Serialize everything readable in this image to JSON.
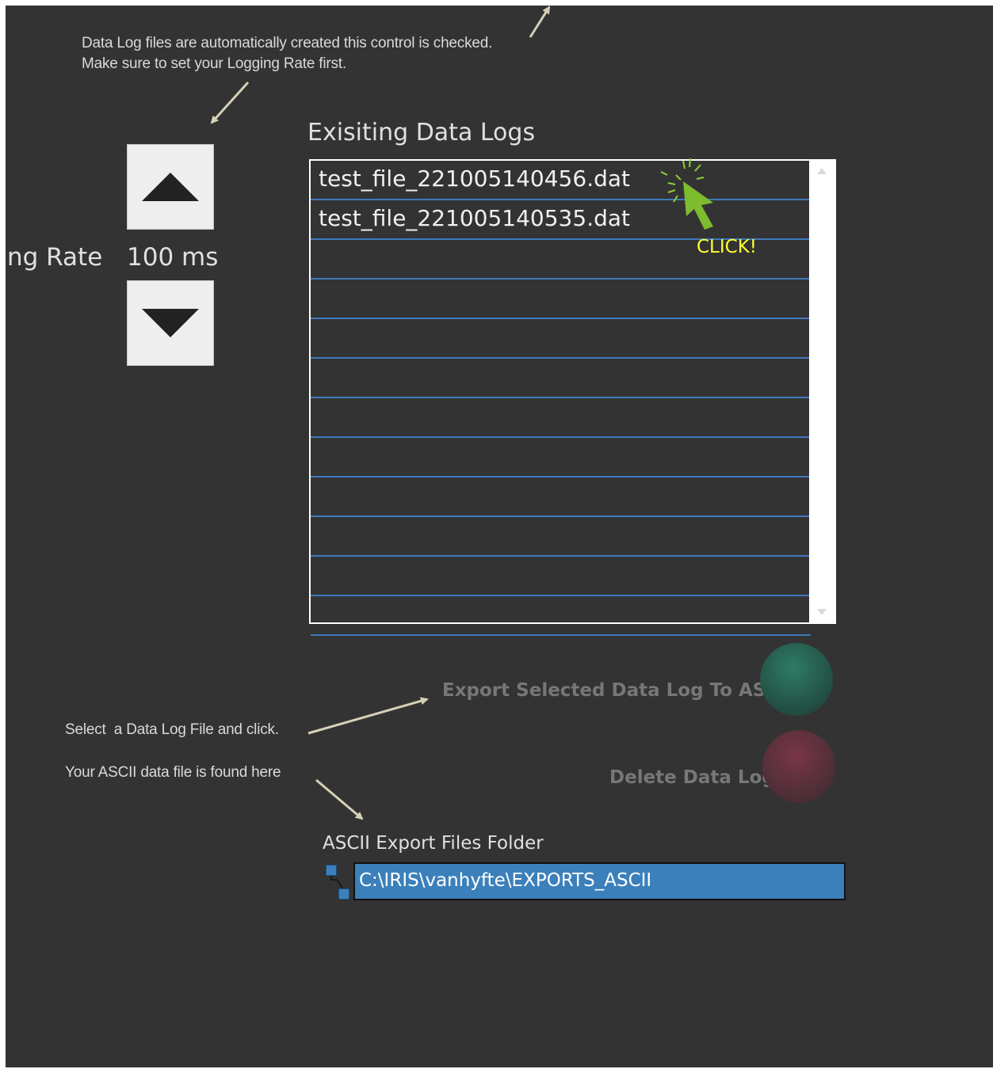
{
  "notes": {
    "auto_create": "Data Log files are automatically created this control is checked.\nMake sure to set your Logging Rate first.",
    "select_hint": "Select  a Data Log File and click.",
    "ascii_found": "Your ASCII data file is found here"
  },
  "logging_rate": {
    "label": "ng Rate",
    "value": "100 ms",
    "increase_icon": "triangle-up-icon",
    "decrease_icon": "triangle-down-icon"
  },
  "data_logs": {
    "title": "Exisiting Data Logs",
    "items": [
      "test_file_221005140456.dat",
      "test_file_221005140535.dat",
      "",
      "",
      "",
      "",
      "",
      "",
      "",
      "",
      "",
      ""
    ],
    "click_callout": "CLICK!"
  },
  "actions": {
    "export_label": "Export Selected Data Log To ASCII",
    "delete_label": "Delete Data Log",
    "export_color": "#2a6b5a",
    "delete_color": "#6e3040"
  },
  "export_folder": {
    "label": "ASCII Export Files Folder",
    "path": "C:\\IRIS\\vanhyfte\\EXPORTS_ASCII"
  },
  "colors": {
    "background": "#333333",
    "row_divider": "#3e79bc",
    "path_fill": "#3b80bb",
    "callout": "#ffff33",
    "cursor": "#7dbb2f"
  }
}
